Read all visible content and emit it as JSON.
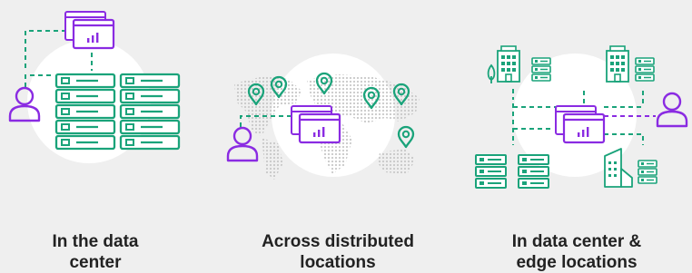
{
  "panels": [
    {
      "caption_line1": "In the data",
      "caption_line2": "center"
    },
    {
      "caption_line1": "Across distributed",
      "caption_line2": "locations"
    },
    {
      "caption_line1": "In data center &",
      "caption_line2": "edge locations"
    }
  ],
  "colors": {
    "green": "#1aa37a",
    "purple": "#8a2be2",
    "background": "#efefef",
    "circle": "#ffffff",
    "map": "#cfcfcf",
    "text": "#222222"
  },
  "icons": [
    "user-icon",
    "dashboard-window-icon",
    "server-rack-icon",
    "location-pin-icon",
    "office-building-icon",
    "tree-icon"
  ]
}
